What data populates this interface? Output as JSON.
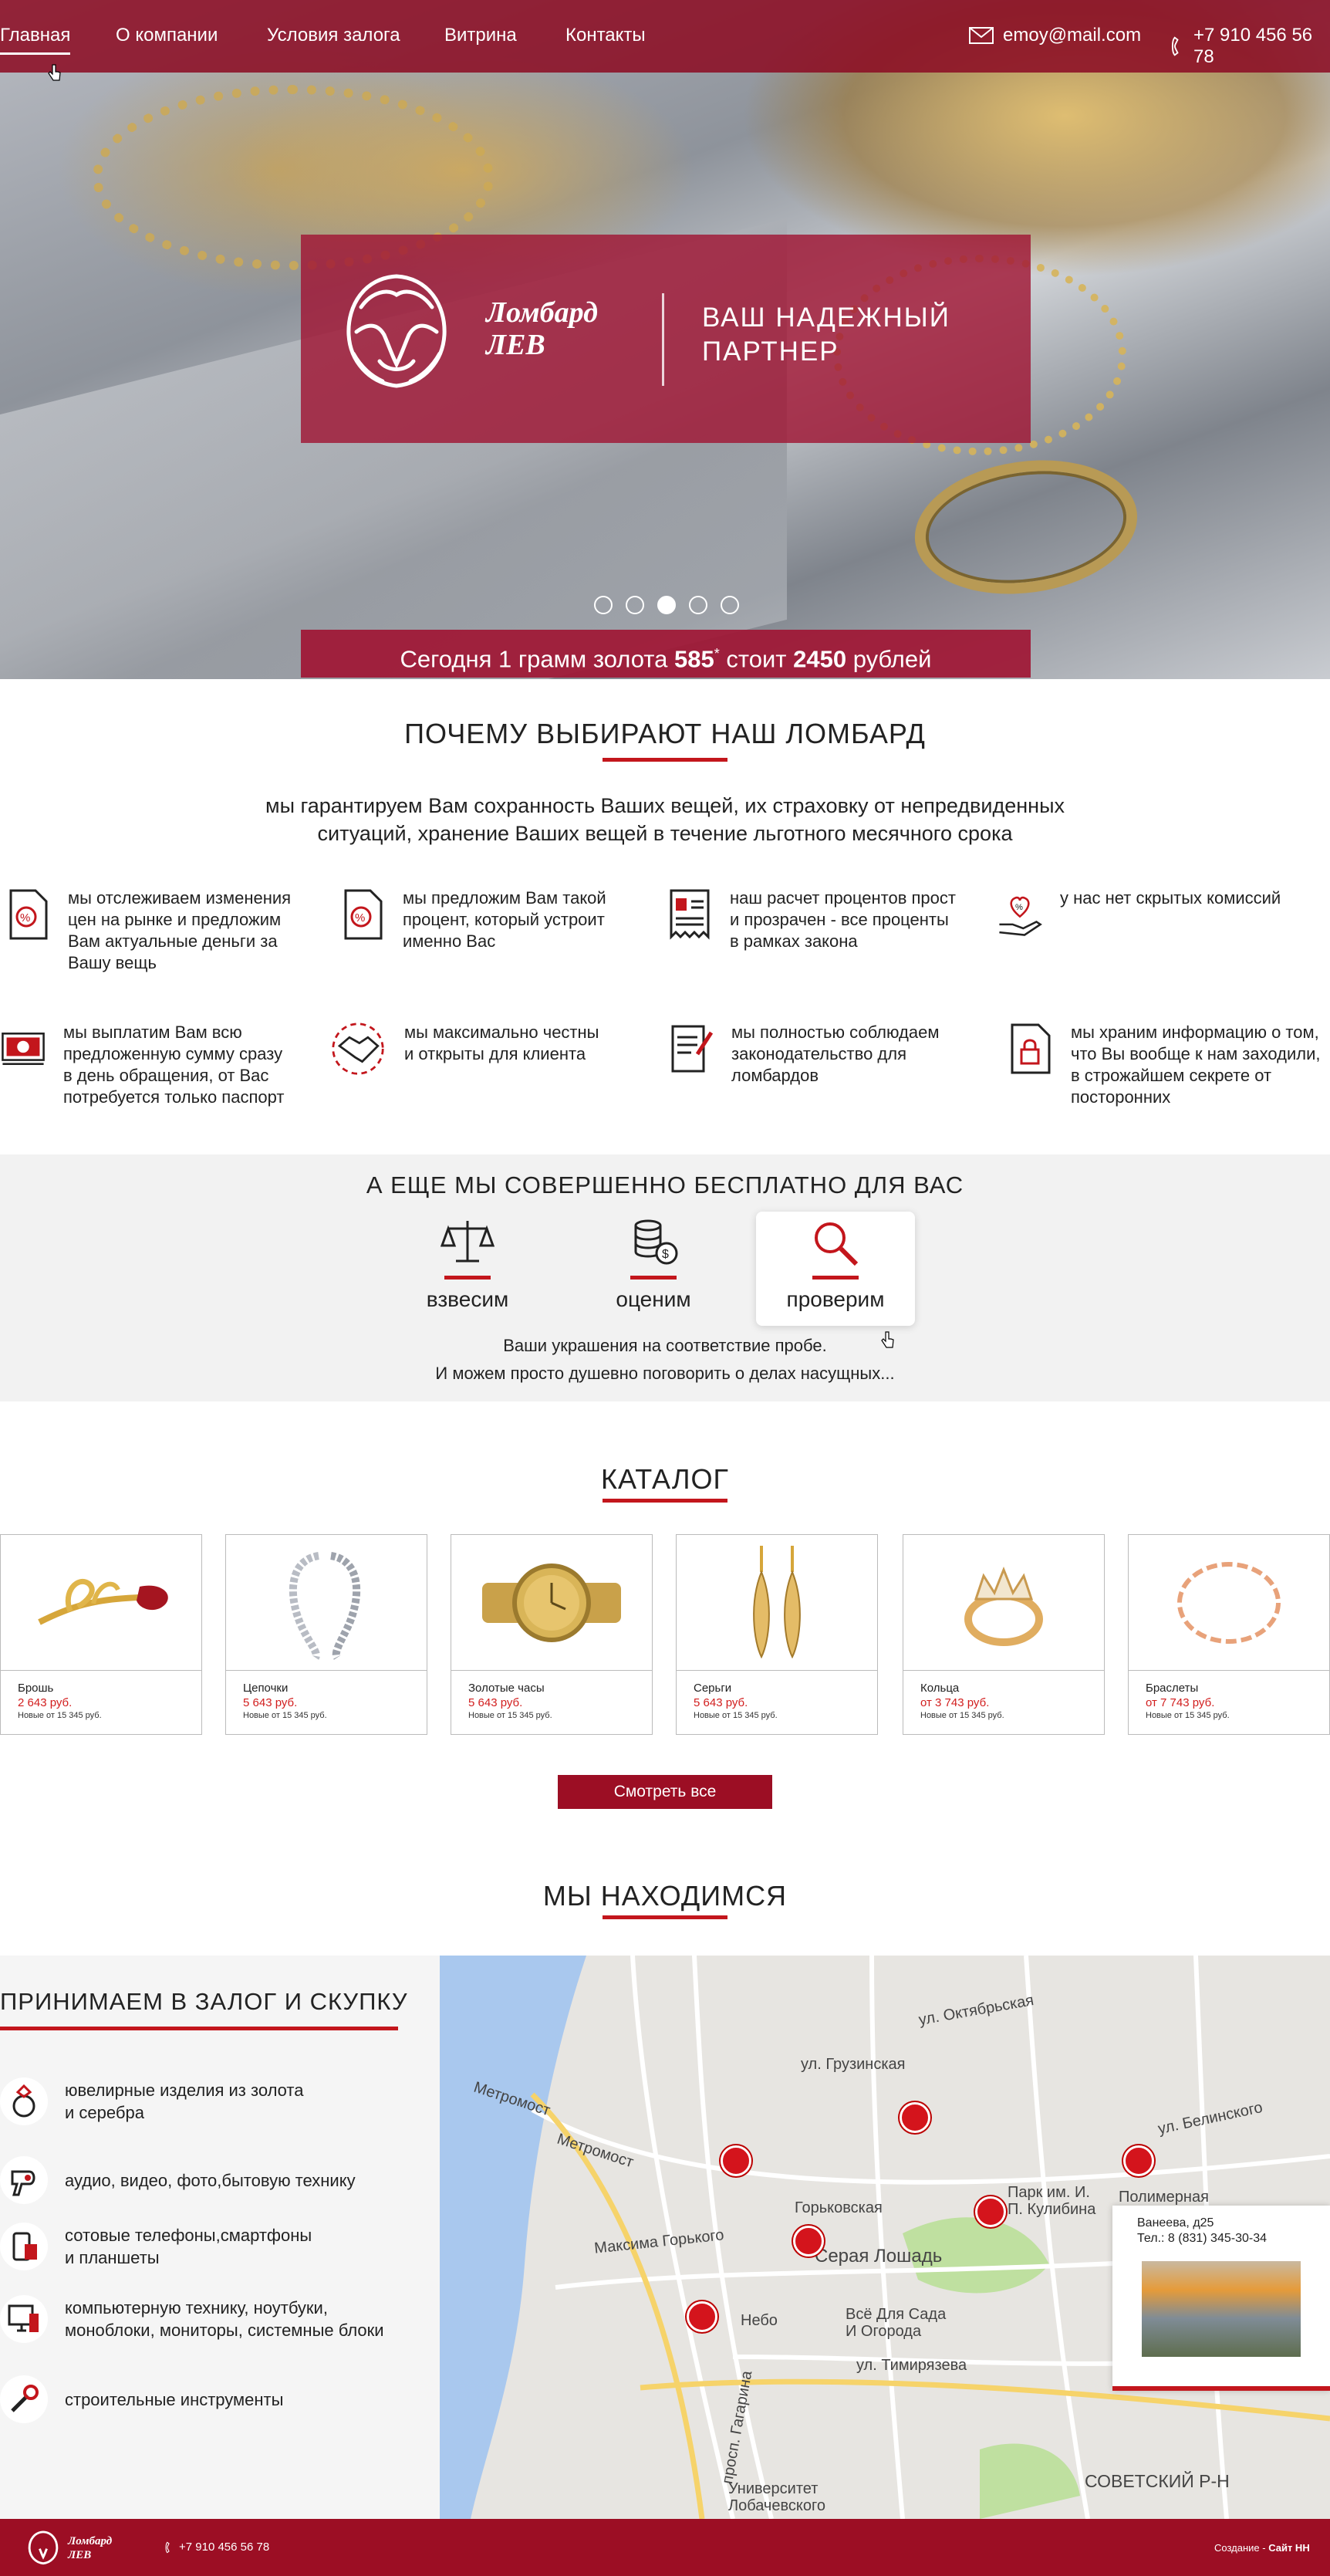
{
  "nav": {
    "items": [
      "Главная",
      "О компании",
      "Условия залога",
      "Витрина",
      "Контакты"
    ],
    "email": "emoy@mail.com",
    "phone": "+7 910 456 56 78"
  },
  "hero": {
    "brand_line1": "Ломбард",
    "brand_line2": "ЛЕВ",
    "tagline1": "ВАШ НАДЕЖНЫЙ",
    "tagline2": "ПАРТНЕР",
    "price_prefix": "Сегодня 1 грамм золота",
    "purity": "585",
    "purity_mark": "*",
    "price_mid": "стоит",
    "price": "2450",
    "price_suffix": "рублей",
    "slides_total": 5,
    "slide_active": 3
  },
  "why": {
    "title": "ПОЧЕМУ ВЫБИРАЮТ НАШ ЛОМБАРД",
    "subtitle1": "мы гарантируем Вам сохранность Ваших вещей, их страховку от непредвиденных",
    "subtitle2": "ситуаций, хранение Ваших вещей в течение льготного месячного срока",
    "features": [
      {
        "icon": "percent-document-icon",
        "lines": [
          "мы отслеживаем изменения",
          "цен на рынке и предложим",
          "Вам актуальные деньги за",
          "Вашу вещь"
        ]
      },
      {
        "icon": "percent-document-icon",
        "lines": [
          "мы предложим Вам такой",
          "процент, который устроит",
          "именно Вас"
        ]
      },
      {
        "icon": "receipt-icon",
        "lines": [
          "наш расчет процентов прост",
          "и прозрачен - все проценты",
          "в рамках закона"
        ]
      },
      {
        "icon": "heart-hand-icon",
        "lines": [
          "у нас нет скрытых комиссий"
        ]
      },
      {
        "icon": "cash-icon",
        "lines": [
          "мы выплатим Вам всю",
          "предложенную сумму сразу",
          "в день обращения, от Вас",
          "потребуется только паспорт"
        ]
      },
      {
        "icon": "handshake-icon",
        "lines": [
          "мы максимально честны",
          "и открыты для клиента"
        ]
      },
      {
        "icon": "law-document-icon",
        "lines": [
          "мы полностью соблюдаем",
          "законодательство для",
          "ломбардов"
        ]
      },
      {
        "icon": "lock-document-icon",
        "lines": [
          "мы храним информацию о том,",
          "что Вы вообще к нам заходили,",
          "в строжайшем секрете от",
          "посторонних"
        ]
      }
    ]
  },
  "free": {
    "title": "А ЕЩЕ МЫ СОВЕРШЕННО БЕСПЛАТНО ДЛЯ ВАС",
    "items": [
      {
        "label": "взвесим",
        "icon": "scales-icon"
      },
      {
        "label": "оценим",
        "icon": "coins-icon"
      },
      {
        "label": "проверим",
        "icon": "magnifier-icon"
      }
    ],
    "note1": "Ваши украшения на соответствие пробе.",
    "note2": "И можем просто душевно поговорить о делах насущных..."
  },
  "catalog": {
    "title": "КАТАЛОГ",
    "items": [
      {
        "name": "Брошь",
        "price": "2 643 руб.",
        "note": "Новые от 15 345 руб."
      },
      {
        "name": "Цепочки",
        "price": "5 643 руб.",
        "note": "Новые от 15 345 руб."
      },
      {
        "name": "Золотые часы",
        "price": "5 643 руб.",
        "note": "Новые от 15 345 руб."
      },
      {
        "name": "Серьги",
        "price": "5 643 руб.",
        "note": "Новые от 15 345 руб."
      },
      {
        "name": "Кольца",
        "price": "от 3 743 руб.",
        "note": "Новые от 15 345 руб."
      },
      {
        "name": "Браслеты",
        "price": "от 7 743 руб.",
        "note": "Новые от 15 345 руб."
      }
    ],
    "view_all": "Смотреть все"
  },
  "location": {
    "title": "МЫ НАХОДИМСЯ",
    "pledge_title": "ПРИНИМАЕМ В ЗАЛОГ И СКУПКУ",
    "pledge_items": [
      {
        "icon": "ring-icon",
        "lines": [
          "ювелирные изделия из золота",
          "и серебра"
        ]
      },
      {
        "icon": "hairdryer-icon",
        "lines": [
          "аудио, видео, фото,бытовую технику"
        ]
      },
      {
        "icon": "phone-icon",
        "lines": [
          "сотовые телефоны,смартфоны",
          "и планшеты"
        ]
      },
      {
        "icon": "computer-icon",
        "lines": [
          "компьютерную технику, ноутбуки,",
          "моноблоки, мониторы, системные блоки"
        ]
      },
      {
        "icon": "tools-icon",
        "lines": [
          "строительные инструменты"
        ]
      }
    ],
    "map_labels": {
      "gorkovskaya": "Горьковская",
      "seraya_loshad": "Серая Лошадь",
      "nebo": "Небо",
      "vsyo_dlya_sada": "Всё Для Сада",
      "i_ogoroda": "И Огорода",
      "park": "Парк им. И.",
      "kulibina": "П. Кулибина",
      "polimer": "Полимерная",
      "sovetsky": "СОВЕТСКИЙ Р-Н",
      "metromost": "Метромост",
      "metromost2": "Метромост",
      "universitet": "Университет",
      "lobachevskogo": "Лобачевского",
      "street_oktyabrskaya": "ул. Октябрьская",
      "street_gruzinskaya": "ул. Грузинская",
      "street_maksima": "Максима Горького",
      "street_belinskogo": "ул. Белинского",
      "street_gagarina": "просп. Гагарина",
      "street_timiryazeva": "ул. Тимирязева"
    },
    "info_address": "Ванеева, д25",
    "info_phone": "Тел.: 8 (831) 345-30-34"
  },
  "footer": {
    "brand_line1": "Ломбард",
    "brand_line2": "ЛЕВ",
    "phone": "+7 910 456 56 78",
    "credit_prefix": "Создание - ",
    "credit_name": "Сайт НН"
  },
  "colors": {
    "accent": "#9c0e24",
    "red": "#c3161c",
    "price": "#d21e1e"
  }
}
